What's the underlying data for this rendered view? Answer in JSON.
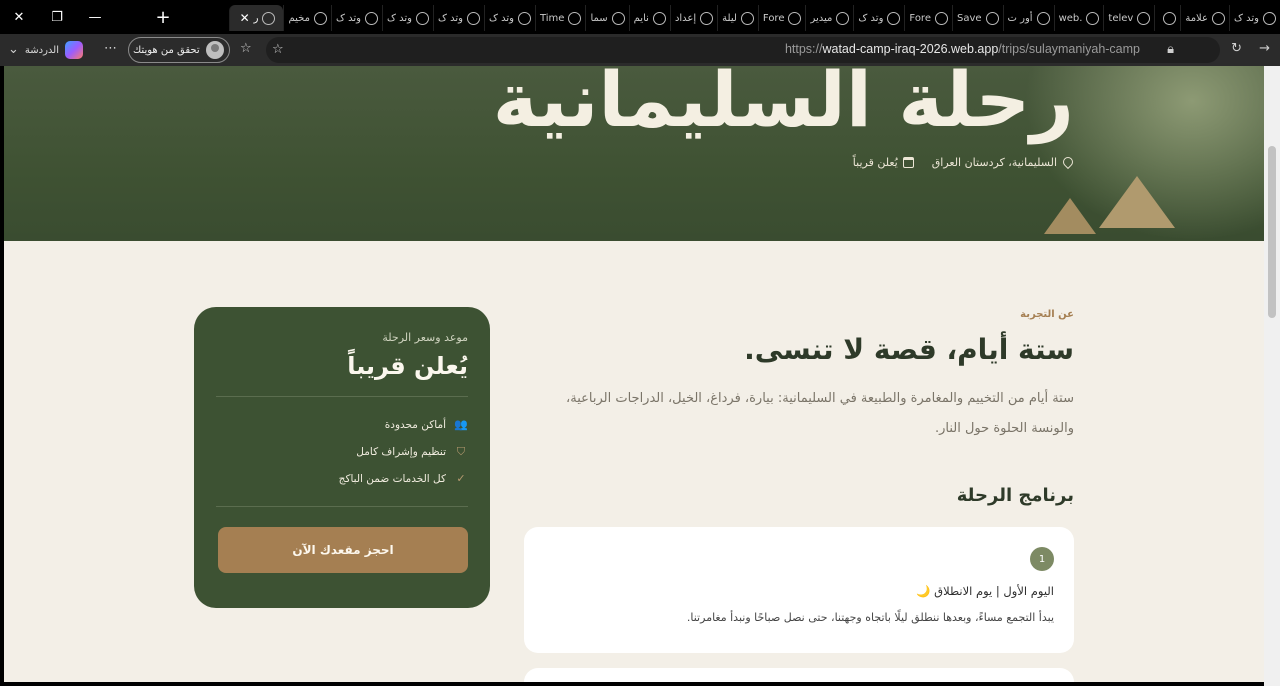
{
  "browser": {
    "tabs": [
      {
        "label": "وتد ک",
        "active": false
      },
      {
        "label": "علامة",
        "active": false
      },
      {
        "label": "",
        "active": false
      },
      {
        "label": "telev",
        "active": false
      },
      {
        "label": "web.",
        "active": false
      },
      {
        "label": "أور ت",
        "active": false
      },
      {
        "label": "Save",
        "active": false
      },
      {
        "label": "Fore",
        "active": false
      },
      {
        "label": "وتد ک",
        "active": false
      },
      {
        "label": "ميدير",
        "active": false
      },
      {
        "label": "Fore",
        "active": false
      },
      {
        "label": "ليلة",
        "active": false
      },
      {
        "label": "إعداد",
        "active": false
      },
      {
        "label": "نايم",
        "active": false
      },
      {
        "label": "سما",
        "active": false
      },
      {
        "label": "Time",
        "active": false
      },
      {
        "label": "وتد ک",
        "active": false
      },
      {
        "label": "وتد ک",
        "active": false
      },
      {
        "label": "وتد ک",
        "active": false
      },
      {
        "label": "وتد ک",
        "active": false
      },
      {
        "label": "مخيم",
        "active": false
      },
      {
        "label": "ر",
        "active": true
      }
    ],
    "url_prefix": "https://",
    "url_host": "watad-camp-iraq-2026.web.app",
    "url_path": "/trips/sulaymaniyah-camp",
    "identity_label": "تحقق من هويتك",
    "chat_label": "الدردشة"
  },
  "hero": {
    "title": "رحلة السليمانية",
    "location": "السليمانية، كردستان العراق",
    "date": "يُعلن قريباً"
  },
  "booking": {
    "subtitle": "موعد وسعر الرحلة",
    "title": "يُعلن قريباً",
    "features": [
      {
        "icon": "users-icon",
        "glyph": "👥",
        "label": "أماكن محدودة"
      },
      {
        "icon": "shield-icon",
        "glyph": "⛉",
        "label": "تنظيم وإشراف كامل"
      },
      {
        "icon": "check-icon",
        "glyph": "✓",
        "label": "كل الخدمات ضمن الباكج"
      }
    ],
    "button_label": "احجز مقعدك الآن"
  },
  "about": {
    "kicker": "عن التجربة",
    "title": "ستة أيام، قصة لا تنسى.",
    "body": "ستة أيام من التخييم والمغامرة والطبيعة في السليمانية: بيارة، فرداغ، الخيل، الدراجات الرباعية، والونسة الحلوة حول النار."
  },
  "program": {
    "title": "برنامج الرحلة",
    "days": [
      {
        "number": "1",
        "heading": "اليوم الأول | يوم الانطلاق 🌙",
        "description": "يبدأ التجمع مساءً، وبعدها ننطلق ليلًا باتجاه وجهتنا، حتى نصل صباحًا ونبدأ مغامرتنا."
      }
    ]
  },
  "colors": {
    "forest": "#3d5233",
    "sand": "#a57f52",
    "cream": "#f3efe7"
  }
}
